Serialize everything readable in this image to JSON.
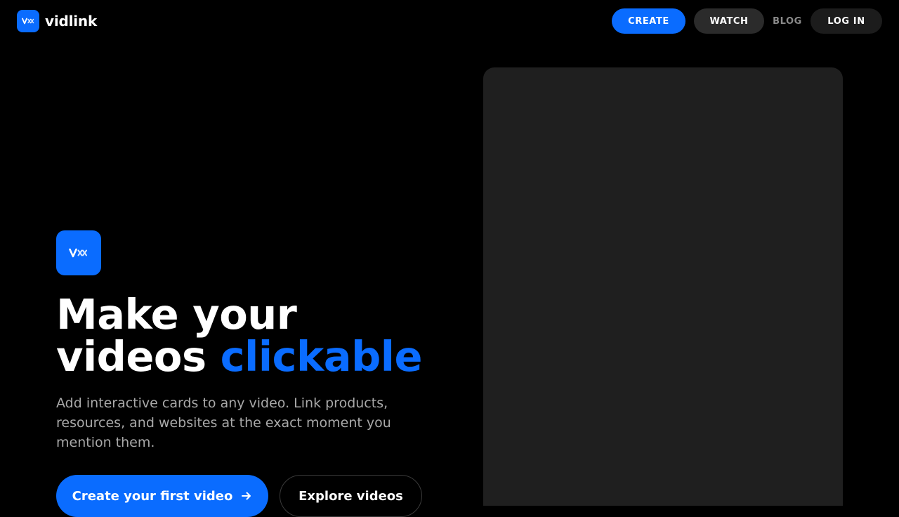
{
  "brand": {
    "name": "vidlink",
    "logo_icon": "vidlink-logo-icon",
    "accent_color": "#0a6cff"
  },
  "nav": {
    "create": "CREATE",
    "watch": "WATCH",
    "blog": "BLOG",
    "login": "LOG IN"
  },
  "hero": {
    "headline_line1": "Make your",
    "headline_line2_plain": "videos ",
    "headline_line2_accent": "clickable",
    "subtext": "Add interactive cards to any video. Link products, resources, and websites at the exact moment you mention them.",
    "cta_primary": "Create your first video",
    "cta_primary_icon": "arrow-right-icon",
    "cta_secondary": "Explore videos"
  },
  "colors": {
    "background": "#000000",
    "accent": "#0a6cff",
    "panel": "#1f1f1f",
    "muted_text": "#a9a9a9"
  }
}
